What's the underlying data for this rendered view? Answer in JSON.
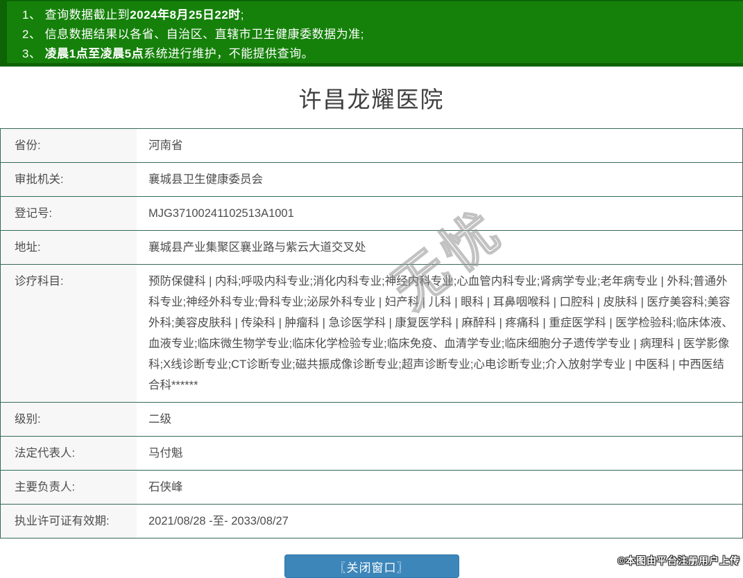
{
  "banner": {
    "bg_color": "#15810a",
    "edge_color": "#0c6405",
    "text_color": "#ffffff",
    "notices": [
      {
        "pre": "1、 查询数据截止到",
        "bold": "2024年8月25日22时",
        "post": ";"
      },
      {
        "pre": "2、 信息数据结果以各省、自治区、直辖市卫生健康委数据为准;",
        "bold": "",
        "post": ""
      },
      {
        "pre": "3、 ",
        "bold": "凌晨1点至凌晨5点",
        "post": "系统进行维护，不能提供查询。"
      }
    ]
  },
  "page": {
    "title": "许昌龙耀医院"
  },
  "table": {
    "border_color": "#336957",
    "label_bg": "#f7f7f7",
    "rows": [
      {
        "label": "省份:",
        "value": "河南省"
      },
      {
        "label": "审批机关:",
        "value": "襄城县卫生健康委员会"
      },
      {
        "label": "登记号:",
        "value": "MJG37100241102513A1001"
      },
      {
        "label": "地址:",
        "value": "襄城县产业集聚区襄业路与紫云大道交叉处"
      },
      {
        "label": "诊疗科目:",
        "value": "预防保健科 | 内科;呼吸内科专业;消化内科专业;神经内科专业;心血管内科专业;肾病学专业;老年病专业 | 外科;普通外科专业;神经外科专业;骨科专业;泌尿外科专业 | 妇产科 | 儿科 | 眼科 | 耳鼻咽喉科 | 口腔科 | 皮肤科 | 医疗美容科;美容外科;美容皮肤科 | 传染科 | 肿瘤科 | 急诊医学科 | 康复医学科 | 麻醉科 | 疼痛科 | 重症医学科 | 医学检验科;临床体液、血液专业;临床微生物学专业;临床化学检验专业;临床免疫、血清学专业;临床细胞分子遗传学专业 | 病理科 | 医学影像科;X线诊断专业;CT诊断专业;磁共振成像诊断专业;超声诊断专业;心电诊断专业;介入放射学专业 | 中医科 | 中西医结合科******"
      },
      {
        "label": "级别:",
        "value": "二级"
      },
      {
        "label": "法定代表人:",
        "value": "马付魁"
      },
      {
        "label": "主要负责人:",
        "value": "石侠峰"
      },
      {
        "label": "执业许可证有效期:",
        "value": "2021/08/28 -至- 2033/08/27"
      }
    ]
  },
  "footer": {
    "close_button_label": "〖关闭窗口〗",
    "button_color": "#3c86ba",
    "copyright": "©本图由平台注册用户上传"
  },
  "watermark": {
    "visible_text": "无忧"
  }
}
